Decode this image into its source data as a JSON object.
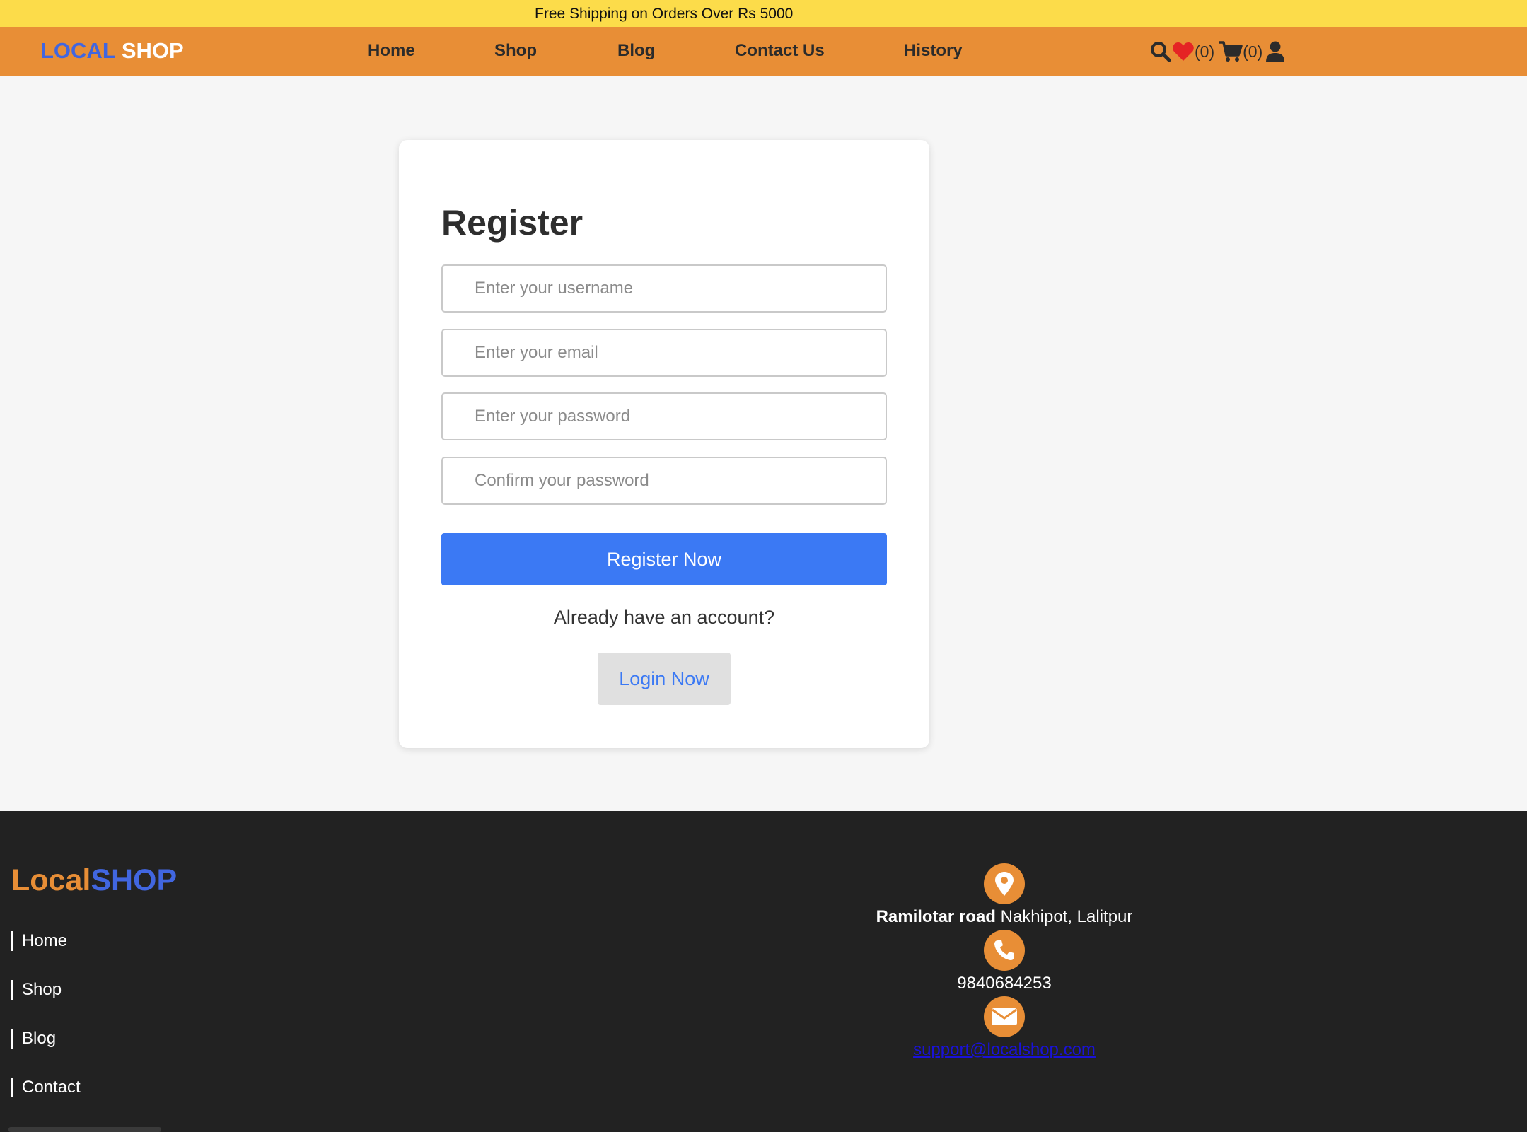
{
  "topbar": {
    "promo": "Free Shipping on Orders Over Rs 5000"
  },
  "header": {
    "logo_part1": "LOCAL",
    "logo_part2": "SHOP",
    "nav": [
      "Home",
      "Shop",
      "Blog",
      "Contact Us",
      "History"
    ],
    "wishlist_count": "(0)",
    "cart_count": "(0)",
    "icons": [
      "search-icon",
      "heart-icon",
      "cart-icon",
      "user-icon"
    ]
  },
  "form": {
    "title": "Register",
    "username_placeholder": "Enter your username",
    "email_placeholder": "Enter your email",
    "password_placeholder": "Enter your password",
    "confirm_placeholder": "Confirm your password",
    "submit_label": "Register Now",
    "already_text": "Already have an account?",
    "login_label": "Login Now"
  },
  "footer": {
    "logo_part1": "Local",
    "logo_part2": "SHOP",
    "links": [
      "Home",
      "Shop",
      "Blog",
      "Contact"
    ],
    "address_bold": "Ramilotar road",
    "address_rest": "Nakhipot, Lalitpur",
    "phone": "9840684253",
    "email": "support@localshop.com"
  },
  "colors": {
    "topbar": "#fcdc4a",
    "header": "#e88e36",
    "accent_blue": "#3b79f4",
    "logo_blue": "#4166e0",
    "footer_bg": "#222222",
    "heart": "#e52424"
  }
}
